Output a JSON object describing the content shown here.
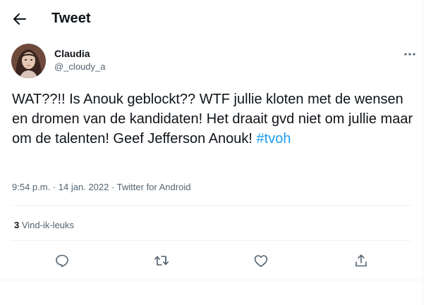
{
  "header": {
    "title": "Tweet",
    "back_icon": "arrow-left-icon"
  },
  "tweet": {
    "author": {
      "display_name": "Claudia",
      "handle": "@_cloudy_a"
    },
    "text_main": "WAT??!! Is Anouk geblockt?? WTF jullie kloten met de wensen en dromen van de kandidaten! Het draait gvd niet om jullie maar om de talenten! Geef Jefferson Anouk! ",
    "hashtag": "#tvoh",
    "time": "9:54 p.m.",
    "separator": " · ",
    "date": "14 jan. 2022",
    "source": "Twitter for Android",
    "likes_count": "3",
    "likes_label": " Vind-ik-leuks"
  },
  "actions": [
    {
      "name": "reply-icon"
    },
    {
      "name": "retweet-icon"
    },
    {
      "name": "like-icon"
    },
    {
      "name": "share-icon"
    }
  ],
  "colors": {
    "accent": "#1d9bf0",
    "text": "#0f1419",
    "muted": "#536471",
    "divider": "#eff3f4"
  }
}
